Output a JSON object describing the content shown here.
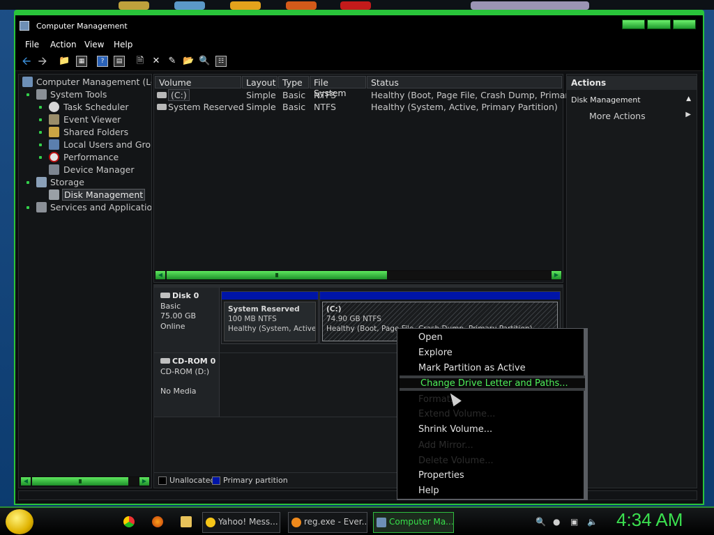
{
  "window": {
    "title": "Computer Management"
  },
  "menu": {
    "file": "File",
    "action": "Action",
    "view": "View",
    "help": "Help"
  },
  "toolbar": [
    "back-icon",
    "forward-icon",
    "up-folder-icon",
    "show-hide-tree-icon",
    "help-icon",
    "console-icon",
    "properties-icon",
    "delete-icon",
    "settings-icon",
    "open-icon",
    "search-icon",
    "export-icon"
  ],
  "tree": {
    "root": "Computer Management (Loc",
    "items": [
      {
        "label": "System Tools",
        "level": 1
      },
      {
        "label": "Task Scheduler",
        "level": 2
      },
      {
        "label": "Event Viewer",
        "level": 2
      },
      {
        "label": "Shared Folders",
        "level": 2
      },
      {
        "label": "Local Users and Grou",
        "level": 2
      },
      {
        "label": "Performance",
        "level": 2
      },
      {
        "label": "Device Manager",
        "level": 2
      },
      {
        "label": "Storage",
        "level": 1
      },
      {
        "label": "Disk Management",
        "level": 2,
        "selected": true
      },
      {
        "label": "Services and Application",
        "level": 1
      }
    ]
  },
  "volumes": {
    "columns": [
      "Volume",
      "Layout",
      "Type",
      "File System",
      "Status"
    ],
    "rows": [
      {
        "volume": "(C:)",
        "layout": "Simple",
        "type": "Basic",
        "fs": "NTFS",
        "status": "Healthy (Boot, Page File, Crash Dump, Primary"
      },
      {
        "volume": "System Reserved",
        "layout": "Simple",
        "type": "Basic",
        "fs": "NTFS",
        "status": "Healthy (System, Active, Primary Partition)"
      }
    ]
  },
  "disks": {
    "disk0": {
      "name": "Disk 0",
      "type": "Basic",
      "size": "75.00 GB",
      "state": "Online"
    },
    "cdrom0": {
      "name": "CD-ROM 0",
      "drive": "CD-ROM (D:)",
      "media": "No Media"
    },
    "p1": {
      "name": "System Reserved",
      "size": "100 MB NTFS",
      "status": "Healthy (System, Active, P"
    },
    "p2": {
      "name": "(C:)",
      "size": "74.90 GB NTFS",
      "status": "Healthy (Boot, Page File, Crash Dump, Primary Partition)"
    }
  },
  "legend": {
    "unallocated": "Unallocated",
    "primary": "Primary partition",
    "unallocated_color": "#000000",
    "primary_color": "#0015a8"
  },
  "actions": {
    "header": "Actions",
    "section": "Disk Management",
    "more": "More Actions"
  },
  "context_menu": {
    "open": "Open",
    "explore": "Explore",
    "mark_active": "Mark Partition as Active",
    "change_letter": "Change Drive Letter and Paths...",
    "format": "Format...",
    "extend": "Extend Volume...",
    "shrink": "Shrink Volume...",
    "add_mirror": "Add Mirror...",
    "delete": "Delete Volume...",
    "properties": "Properties",
    "help": "Help"
  },
  "taskbar": {
    "items": [
      {
        "label": "Yahoo! Mess...",
        "icon": "yahoo-messenger-icon"
      },
      {
        "label": "reg.exe - Ever...",
        "icon": "search-everything-icon"
      },
      {
        "label": "Computer Ma...",
        "icon": "computer-management-icon",
        "active": true
      }
    ],
    "clock": "4:34 AM"
  },
  "colors": {
    "accent": "#38e04b",
    "partition_bar": "#0015a8"
  }
}
